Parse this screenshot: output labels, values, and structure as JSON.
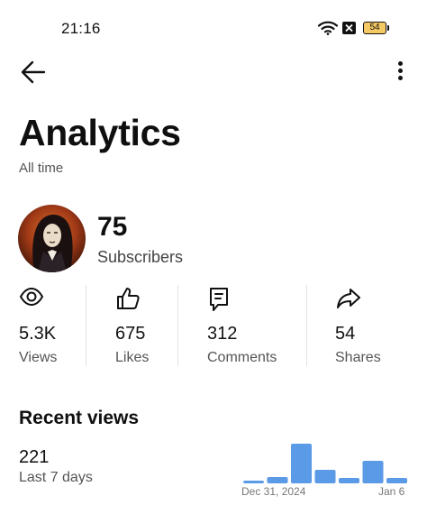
{
  "status_bar": {
    "time": "21:16",
    "battery": "54",
    "icons": [
      "wifi-icon",
      "notification-x-icon",
      "battery-icon"
    ]
  },
  "toolbar": {
    "back_icon": "arrow-left-icon",
    "more_icon": "more-vertical-icon"
  },
  "page": {
    "title": "Analytics",
    "subtitle": "All time"
  },
  "channel": {
    "subscriber_count": "75",
    "subscriber_label": "Subscribers"
  },
  "stats": [
    {
      "icon": "eye-icon",
      "value": "5.3K",
      "label": "Views"
    },
    {
      "icon": "thumbs-up-icon",
      "value": "675",
      "label": "Likes"
    },
    {
      "icon": "comment-icon",
      "value": "312",
      "label": "Comments"
    },
    {
      "icon": "share-icon",
      "value": "54",
      "label": "Shares"
    }
  ],
  "recent_views": {
    "title": "Recent views",
    "count": "221",
    "period": "Last 7 days",
    "chart_data": {
      "type": "bar",
      "values": [
        3,
        7,
        44,
        15,
        6,
        25,
        6
      ],
      "x_labels": [
        "Dec 31, 2024",
        "Jan 6"
      ],
      "bar_color": "#5b9ae6"
    }
  },
  "colors": {
    "text": "#0f0f0f",
    "secondary_text": "#555555",
    "accent_bar": "#5b9ae6",
    "battery_fill": "#f5c964"
  }
}
